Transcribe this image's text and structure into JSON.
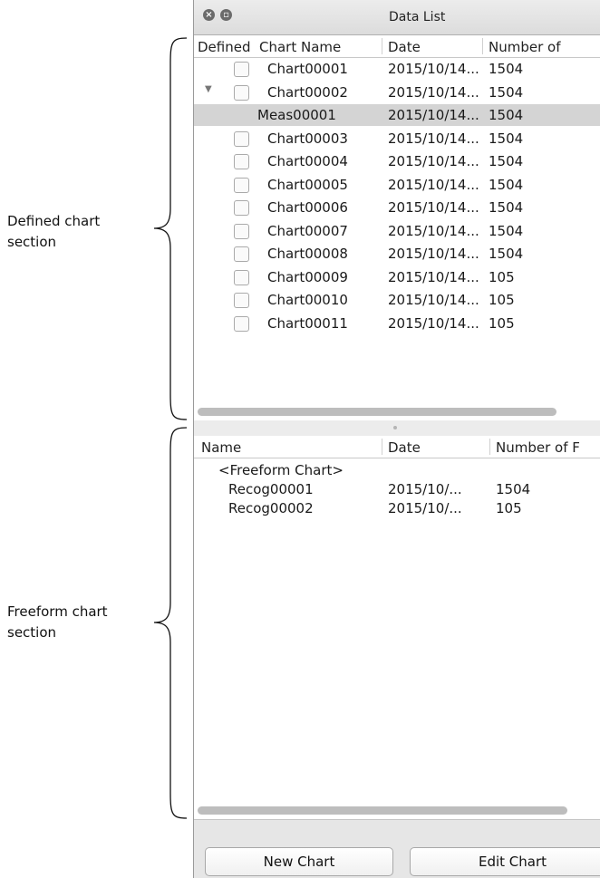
{
  "annotations": {
    "defined": [
      "Defined chart",
      "section"
    ],
    "freeform": [
      "Freeform chart",
      "section"
    ]
  },
  "window": {
    "title": "Data List"
  },
  "defined_list": {
    "headers": {
      "defined": "Defined",
      "chart_name": "Chart Name",
      "date": "Date",
      "number": "Number of"
    },
    "rows": [
      {
        "name": "Chart00001",
        "date": "2015/10/14...",
        "number": "1504",
        "kind": "chart",
        "checkbox": true
      },
      {
        "name": "Chart00002",
        "date": "2015/10/14...",
        "number": "1504",
        "kind": "chart",
        "checkbox": true,
        "expanded": true
      },
      {
        "name": "Meas00001",
        "date": "2015/10/14...",
        "number": "1504",
        "kind": "meas",
        "checkbox": false,
        "selected": true
      },
      {
        "name": "Chart00003",
        "date": "2015/10/14...",
        "number": "1504",
        "kind": "chart",
        "checkbox": true
      },
      {
        "name": "Chart00004",
        "date": "2015/10/14...",
        "number": "1504",
        "kind": "chart",
        "checkbox": true
      },
      {
        "name": "Chart00005",
        "date": "2015/10/14...",
        "number": "1504",
        "kind": "chart",
        "checkbox": true
      },
      {
        "name": "Chart00006",
        "date": "2015/10/14...",
        "number": "1504",
        "kind": "chart",
        "checkbox": true
      },
      {
        "name": "Chart00007",
        "date": "2015/10/14...",
        "number": "1504",
        "kind": "chart",
        "checkbox": true
      },
      {
        "name": "Chart00008",
        "date": "2015/10/14...",
        "number": "1504",
        "kind": "chart",
        "checkbox": true
      },
      {
        "name": "Chart00009",
        "date": "2015/10/14...",
        "number": "105",
        "kind": "chart",
        "checkbox": true
      },
      {
        "name": "Chart00010",
        "date": "2015/10/14...",
        "number": "105",
        "kind": "chart",
        "checkbox": true
      },
      {
        "name": "Chart00011",
        "date": "2015/10/14...",
        "number": "105",
        "kind": "chart",
        "checkbox": true
      }
    ]
  },
  "freeform_list": {
    "headers": {
      "name": "Name",
      "date": "Date",
      "number": "Number of F"
    },
    "rows": [
      {
        "name": "<Freeform Chart>",
        "date": "",
        "number": "",
        "indent": true
      },
      {
        "name": "Recog00001",
        "date": "2015/10/...",
        "number": "1504"
      },
      {
        "name": "Recog00002",
        "date": "2015/10/...",
        "number": "105"
      }
    ]
  },
  "buttons": {
    "new_chart": "New Chart",
    "edit_chart": "Edit Chart"
  },
  "icons": {
    "close": "close-icon",
    "restore": "restore-icon",
    "expand": "disclosure-triangle-icon"
  }
}
